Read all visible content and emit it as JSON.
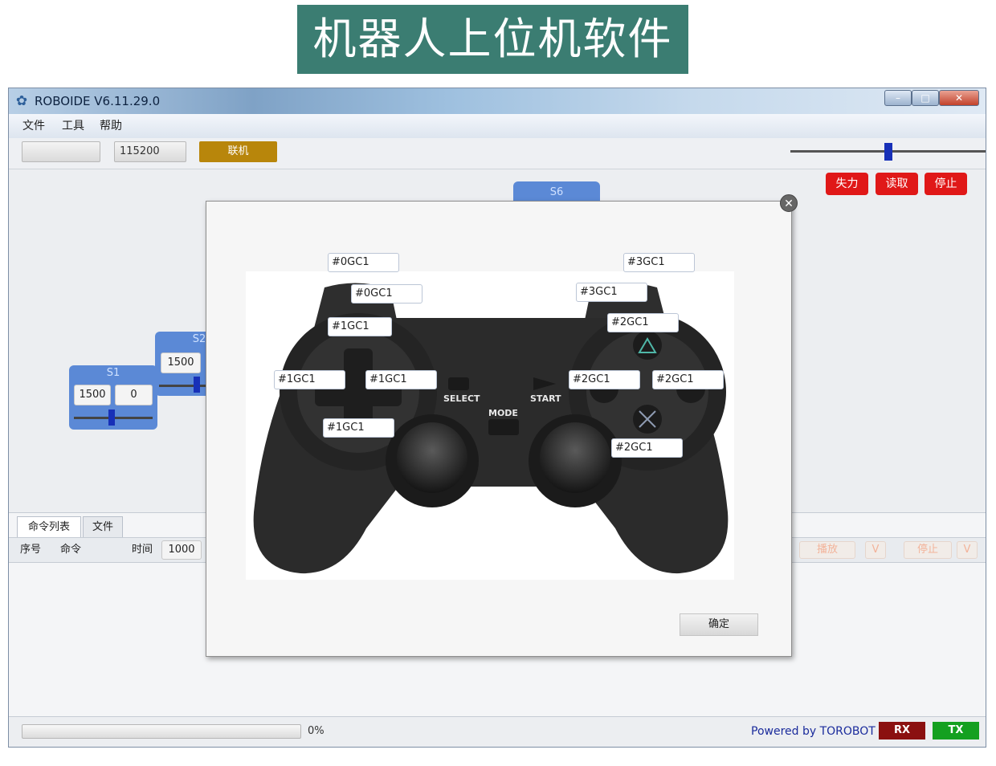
{
  "banner": {
    "title": "机器人上位机软件"
  },
  "window": {
    "title": "ROBOIDE V6.11.29.0",
    "controls": {
      "minimize": "–",
      "maximize": "□",
      "close": "✕"
    }
  },
  "menu": {
    "items": [
      "文件",
      "工具",
      "帮助"
    ]
  },
  "toolbar": {
    "port_value": "",
    "baud_value": "115200",
    "connect_label": "联机",
    "slider_level": 0.5
  },
  "actions": {
    "power_off": "失力",
    "read": "读取",
    "stop": "停止"
  },
  "servos": {
    "s6": {
      "label": "S6"
    },
    "s2": {
      "label": "S2",
      "value": "1500"
    },
    "s1": {
      "label": "S1",
      "value": "1500",
      "offset": "0"
    }
  },
  "bottom": {
    "tabs": [
      "命令列表",
      "文件"
    ],
    "header": {
      "index": "序号",
      "command": "命令",
      "time_label": "时间",
      "time_value": "1000"
    },
    "ghost_buttons": {
      "play": "播放",
      "v1": "V",
      "stop": "停止",
      "v2": "V"
    }
  },
  "status": {
    "progress_text": "0%",
    "powered": "Powered by TOROBOT",
    "rx": "RX",
    "tx": "TX"
  },
  "dialog": {
    "close_glyph": "✕",
    "ok_label": "确定",
    "gamepad_text": {
      "select": "SELECT",
      "start": "START",
      "mode": "MODE"
    },
    "labels": {
      "l2": "#0GC1",
      "l1": "#0GC1",
      "dpad_up": "#1GC1",
      "dpad_left": "#1GC1",
      "dpad_right": "#1GC1",
      "dpad_down": "#1GC1",
      "r2": "#3GC1",
      "r1": "#3GC1",
      "triangle": "#2GC1",
      "square": "#2GC1",
      "circle": "#2GC1",
      "cross": "#2GC1"
    }
  },
  "colors": {
    "accent_red": "#e01818",
    "servo_blue": "#5b89d6",
    "connect_gold": "#b8860b",
    "rx_red": "#8b1010",
    "tx_green": "#14a020",
    "banner_teal": "#3b7d72"
  }
}
